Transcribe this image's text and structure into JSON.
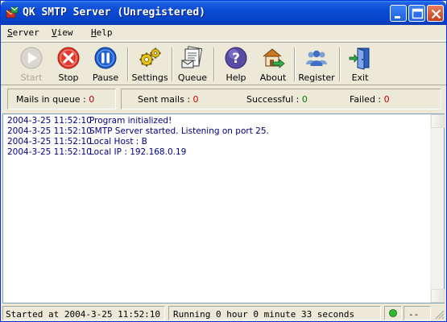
{
  "window": {
    "title": "QK SMTP Server (Unregistered)"
  },
  "menu": {
    "items": [
      {
        "label_ul": "S",
        "label_rest": "erver"
      },
      {
        "label_ul": "V",
        "label_rest": "iew"
      },
      {
        "label_ul": "H",
        "label_rest": "elp"
      }
    ]
  },
  "toolbar": {
    "items": [
      {
        "label": "Start",
        "icon": "play-icon",
        "disabled": true
      },
      {
        "label": "Stop",
        "icon": "stop-icon",
        "disabled": false
      },
      {
        "label": "Pause",
        "icon": "pause-icon",
        "disabled": false
      },
      {
        "label": "Settings",
        "icon": "gears-icon",
        "disabled": false
      },
      {
        "label": "Queue",
        "icon": "mail-queue-icon",
        "disabled": false
      },
      {
        "label": "Help",
        "icon": "help-icon",
        "disabled": false
      },
      {
        "label": "About",
        "icon": "about-icon",
        "disabled": false
      },
      {
        "label": "Register",
        "icon": "users-icon",
        "disabled": false
      },
      {
        "label": "Exit",
        "icon": "exit-door-icon",
        "disabled": false
      }
    ]
  },
  "stats": {
    "queue_label": "Mails in queue :",
    "queue_value": "0",
    "sent_label": "Sent mails :",
    "sent_value": "0",
    "success_label": "Successful :",
    "success_value": "0",
    "failed_label": "Failed :",
    "failed_value": "0"
  },
  "log": {
    "lines": [
      {
        "time": "2004-3-25 11:52:10",
        "msg": "Program initialized!"
      },
      {
        "time": "2004-3-25 11:52:10",
        "msg": "SMTP Server started. Listening on port 25."
      },
      {
        "time": "2004-3-25 11:52:10",
        "msg": "Local Host : B"
      },
      {
        "time": "2004-3-25 11:52:10",
        "msg": "Local IP : 192.168.0.19"
      }
    ]
  },
  "status": {
    "started": "Started at 2004-3-25 11:52:10",
    "running": "Running 0 hour 0 minute 33 seconds",
    "extra": "--",
    "indicator_color": "#2EB82E"
  }
}
